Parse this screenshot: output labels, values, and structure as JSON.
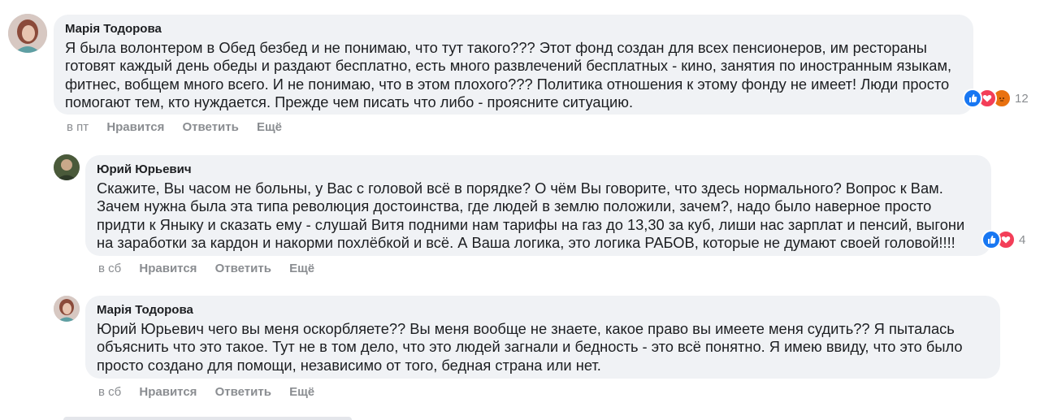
{
  "comments": [
    {
      "author": "Марія Тодорова",
      "text": "Я была волонтером в Обед безбед и не понимаю, что тут такого??? Этот фонд создан для всех пенсионеров, им рестораны готовят каждый день обеды и раздают бесплатно, есть много развлечений бесплатных - кино, занятия по иностранным языкам, фитнес, вобщем много всего. И не понимаю, что в этом плохого??? Политика отношения к этому фонду не имеет! Люди просто помогают тем, кто нуждается. Прежде чем писать что либо - проясните ситуацию.",
      "time": "в пт",
      "like": "Нравится",
      "reply": "Ответить",
      "more": "Ещё",
      "reaction_count": "12"
    },
    {
      "author": "Юрий Юрьевич",
      "text": "Скажите, Вы часом не больны, у Вас с головой всё в порядке? О чём Вы говорите, что здесь нормального? Вопрос к Вам. Зачем нужна была эта типа революция достоинства, где людей в землю положили, зачем?, надо было наверное просто придти к Яныку и сказать ему - слушай Витя подними нам тарифы на газ до 13,30 за куб, лиши нас зарплат и пенсий, выгони на заработки за кардон и накорми похлёбкой и всё. А Ваша логика, это логика РАБОВ, которые не думают своей головой!!!!",
      "time": "в сб",
      "like": "Нравится",
      "reply": "Ответить",
      "more": "Ещё",
      "reaction_count": "4"
    },
    {
      "author": "Марія Тодорова",
      "text": "Юрий Юрьевич чего вы меня оскорбляете?? Вы меня вообще не знаете, какое право вы имеете меня судить?? Я пыталась объяснить что это такое. Тут не в том дело, что это людей загнали и бедность - это всё понятно. Я имею ввиду, что это было просто создано для помощи, независимо от того, бедная страна или нет.",
      "time": "в сб",
      "like": "Нравится",
      "reply": "Ответить",
      "more": "Ещё"
    }
  ],
  "colors": {
    "like": "#1877f2",
    "love": "#f33e58",
    "angry": "#e9710f",
    "bubble": "#f0f2f5",
    "meta": "#8a8d91"
  },
  "icons": [
    "like-reaction-icon",
    "love-reaction-icon",
    "angry-reaction-icon"
  ]
}
